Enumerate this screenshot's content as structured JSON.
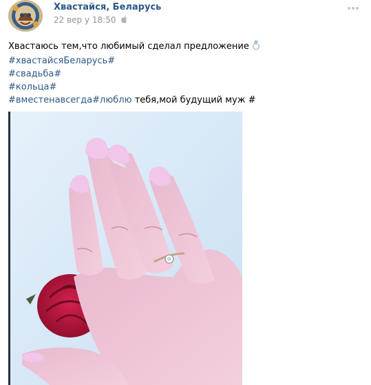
{
  "post": {
    "author": "Хвастайся, Беларусь",
    "date": "22 вер у 18:50",
    "platform_icon": "apple-icon",
    "more_icon": "more-dots-icon",
    "text_lines": [
      {
        "segments": [
          {
            "text": "Хвастаюсь тем,что любимый сделал предложение",
            "type": "text"
          }
        ],
        "emoji": "ring-emoji"
      },
      {
        "segments": [
          {
            "text": "#хвастайсяБеларусь#",
            "type": "hashtag"
          }
        ]
      },
      {
        "segments": [
          {
            "text": "#свадьба#",
            "type": "hashtag"
          }
        ]
      },
      {
        "segments": [
          {
            "text": "#кольца#",
            "type": "hashtag"
          }
        ]
      },
      {
        "segments": [
          {
            "text": "#вместенавсегда#люблю",
            "type": "hashtag"
          },
          {
            "text": " тебя,мой будущий муж #",
            "type": "text"
          }
        ]
      }
    ]
  },
  "colors": {
    "link": "#2a5885",
    "meta": "#939393",
    "text": "#000000",
    "photo_background": "#dceaf7",
    "nail_polish": "#f1c6ea",
    "rose": "#b0143c"
  }
}
